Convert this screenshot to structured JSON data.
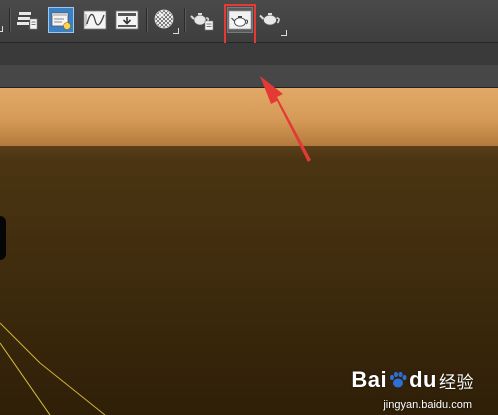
{
  "toolbar": {
    "buttons": [
      {
        "id": "layer-explorer",
        "icon": "layers-icon",
        "state": "normal"
      },
      {
        "id": "scene-explorer",
        "icon": "scene-explorer-icon",
        "state": "active"
      },
      {
        "id": "curve-editor",
        "icon": "curve-editor-icon",
        "state": "normal"
      },
      {
        "id": "schematic-view",
        "icon": "schematic-view-icon",
        "state": "normal"
      },
      {
        "id": "material-editor",
        "icon": "material-editor-icon",
        "state": "normal"
      },
      {
        "id": "render-setup",
        "icon": "render-setup-teapot-icon",
        "state": "normal"
      },
      {
        "id": "rendered-frame-window",
        "icon": "rendered-frame-window-icon",
        "state": "highlighted"
      },
      {
        "id": "render-production",
        "icon": "render-teapot-icon",
        "state": "normal"
      }
    ],
    "accent_color": "#3b7fc4",
    "highlight_color": "#e53935"
  },
  "annotation": {
    "arrow_color": "#e53935"
  },
  "viewport": {
    "wall_color": "#d9a05e",
    "floor_color": "#4b3512",
    "grid_line_color": "#d8c23a"
  },
  "watermark": {
    "logo_part1": "Bai",
    "logo_part2": "du",
    "logo_part3": "经验",
    "url": "jingyan.baidu.com"
  }
}
